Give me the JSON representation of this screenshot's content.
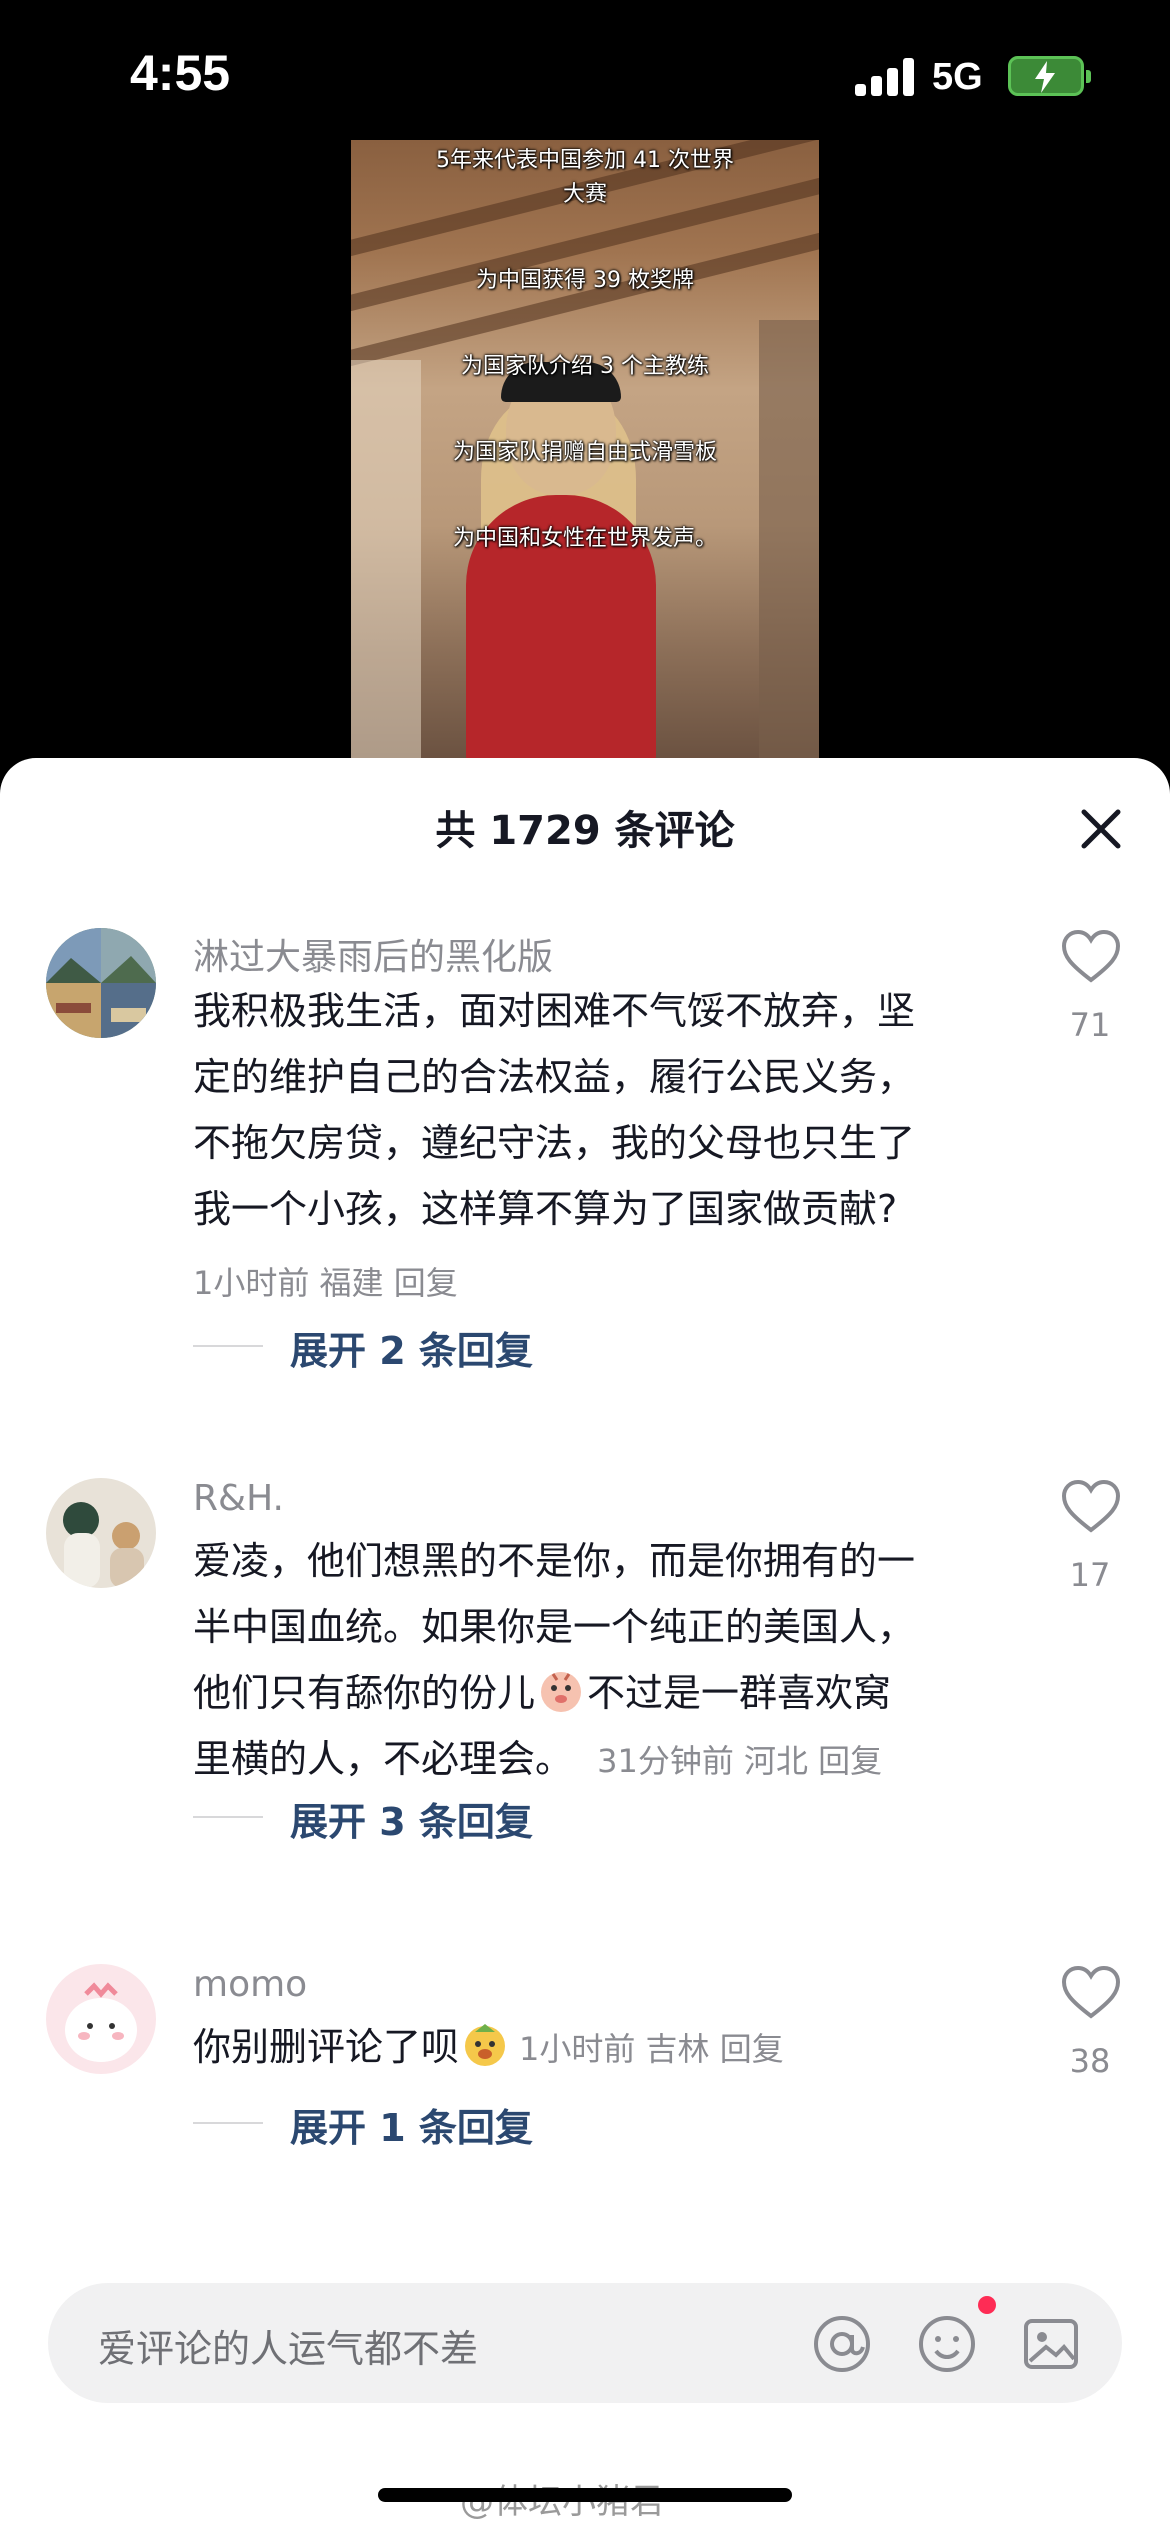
{
  "status_bar": {
    "time": "4:55",
    "network": "5G",
    "battery_charging": true
  },
  "video": {
    "captions": [
      "5年来代表中国参加 41 次世界",
      "大赛",
      "为中国获得 39 枚奖牌",
      "为国家队介绍 3 个主教练",
      "为国家队捐赠自由式滑雪板",
      "为中国和女性在世界发声。"
    ]
  },
  "comments_header": {
    "title": "共 1729 条评论"
  },
  "comments": [
    {
      "username": "淋过大暴雨后的黑化版",
      "text_lines": [
        "我积极我生活，面对困难不气馁不放弃，坚",
        "定的维护自己的合法权益，履行公民义务，",
        "不拖欠房贷，遵纪守法，我的父母也只生了",
        "我一个小孩，这样算不算为了国家做贡献?"
      ],
      "meta": "1小时前 福建 回复",
      "likes": "71",
      "expand": "展开 2 条回复"
    },
    {
      "username": "R&H.",
      "text_lines": [
        "爱凌，他们想黑的不是你，而是你拥有的一",
        "半中国血统。如果你是一个纯正的美国人，",
        "他们只有舔你的份儿",
        "不过是一群喜欢窝",
        "里横的人，不必理会。"
      ],
      "meta": "31分钟前 河北 回复",
      "likes": "17",
      "expand": "展开 3 条回复"
    },
    {
      "username": "momo",
      "text": "你别删评论了呗",
      "meta": "1小时前 吉林 回复",
      "likes": "38",
      "expand": "展开 1 条回复"
    }
  ],
  "input": {
    "placeholder": "爱评论的人运气都不差"
  },
  "watermark": "@体坛小猪君",
  "icons": [
    "close-icon",
    "heart-icon",
    "at-icon",
    "emoji-icon",
    "image-icon"
  ],
  "colors": {
    "expand_link": "#2b4870",
    "secondary_text": "#8a8b91",
    "notify_dot": "#fe2c55",
    "battery": "#5cc256"
  }
}
